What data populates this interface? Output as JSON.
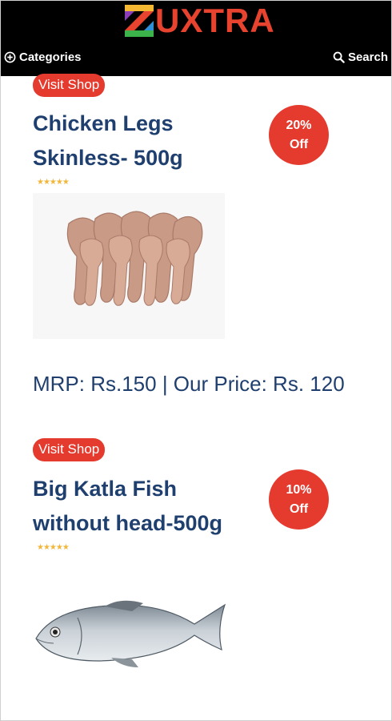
{
  "header": {
    "logo_text": "UXTRA",
    "categories_label": "Categories",
    "search_label": "Search"
  },
  "products": [
    {
      "visit_label": "Visit Shop",
      "title": "Chicken Legs Skinless- 500g",
      "discount_pct": "20%",
      "discount_label": "Off",
      "rating": "★★★★★",
      "price_text": "MRP: Rs.150 | Our Price: Rs. 120"
    },
    {
      "visit_label": "Visit Shop",
      "title": "Big Katla Fish without head-500g",
      "discount_pct": "10%",
      "discount_label": "Off",
      "rating": "★★★★★"
    }
  ],
  "colors": {
    "header_bg": "#000000",
    "accent": "#e53b2f",
    "title": "#1f3f6f",
    "stars": "#f2b63a"
  }
}
